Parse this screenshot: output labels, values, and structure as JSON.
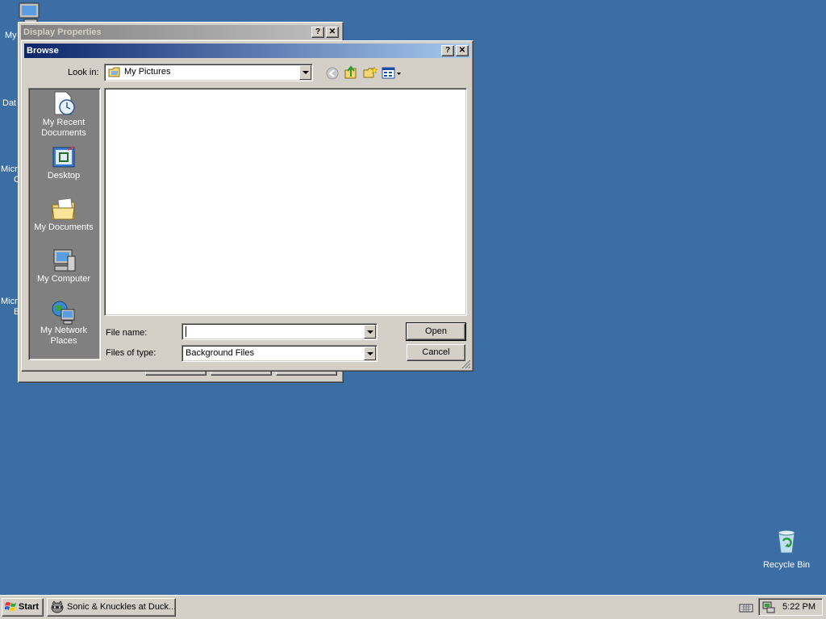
{
  "desktop": {
    "icons": [
      {
        "label": "My",
        "icon": "my-computer-icon"
      },
      {
        "label": "Dat",
        "icon": "desktop-file-icon"
      },
      {
        "label": "Micr",
        "label2": "C",
        "icon": "desktop-file-icon"
      },
      {
        "label": "Micr",
        "label2": "B",
        "icon": "desktop-file-icon"
      },
      {
        "label": "Recycle Bin",
        "icon": "recycle-bin-icon"
      }
    ]
  },
  "display_properties": {
    "title": "Display Properties",
    "help_label": "?",
    "close_label": "✕"
  },
  "browse": {
    "title": "Browse",
    "help_label": "?",
    "close_label": "✕",
    "look_in_label": "Look in:",
    "look_in_value": "My Pictures",
    "places": [
      {
        "label": "My Recent Documents",
        "icon": "recent-documents-icon"
      },
      {
        "label": "Desktop",
        "icon": "desktop-icon"
      },
      {
        "label": "My Documents",
        "icon": "my-documents-icon"
      },
      {
        "label": "My Computer",
        "icon": "my-computer-icon"
      },
      {
        "label": "My Network Places",
        "icon": "network-places-icon"
      }
    ],
    "file_name_label": "File name:",
    "file_name_value": "",
    "files_of_type_label": "Files of type:",
    "files_of_type_value": "Background Files",
    "open_label": "Open",
    "cancel_label": "Cancel"
  },
  "taskbar": {
    "start_label": "Start",
    "tasks": [
      {
        "label": "Sonic & Knuckles at Duck..."
      }
    ],
    "clock": "5:22 PM"
  },
  "colors": {
    "desktop": "#3a6ea5",
    "title_active": "#0a246a",
    "title_inactive": "#808080",
    "places_bar": "#808080",
    "face": "#d4d0c8"
  }
}
